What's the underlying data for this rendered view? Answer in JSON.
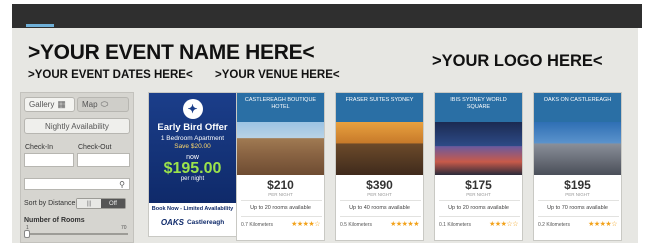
{
  "header": {
    "event_name": ">YOUR EVENT NAME HERE<",
    "event_dates": ">YOUR EVENT DATES HERE<",
    "event_venue": ">YOUR VENUE HERE<",
    "logo": ">YOUR LOGO HERE<"
  },
  "filters": {
    "gallery_label": "Gallery",
    "map_label": "Map",
    "nightly_availability": "Nightly Availability",
    "checkin_label": "Check-In",
    "checkout_label": "Check-Out",
    "checkin_value": "",
    "checkout_value": "",
    "search_value": "",
    "sort_label": "Sort by Distance",
    "toggle_off_label": "Off",
    "rooms_label": "Number of Rooms",
    "rooms_min": "1",
    "rooms_max": "70"
  },
  "ad": {
    "title": "Early Bird Offer",
    "subtitle": "1 Bedroom Apartment",
    "save": "Save $20.00",
    "now": "now",
    "price": "$195.00",
    "per": "per night",
    "cta": "Book Now - Limited Availability",
    "brand": "OAKS",
    "location": "Castlereagh",
    "bird_icon": "bird-icon"
  },
  "hotels": [
    {
      "name": "CASTLEREAGH BOUTIQUE HOTEL",
      "price": "$210",
      "price_note": "PER NIGHT",
      "rooms": "Up to 20 rooms available",
      "distance": "0.7 Kilometers",
      "stars": 4
    },
    {
      "name": "FRASER SUITES SYDNEY",
      "price": "$390",
      "price_note": "PER NIGHT",
      "rooms": "Up to 40 rooms available",
      "distance": "0.5 Kilometers",
      "stars": 5
    },
    {
      "name": "IBIS SYDNEY WORLD SQUARE",
      "price": "$175",
      "price_note": "PER NIGHT",
      "rooms": "Up to 20 rooms available",
      "distance": "0.1 Kilometers",
      "stars": 3
    },
    {
      "name": "OAKS ON CASTLEREAGH",
      "price": "$195",
      "price_note": "PER NIGHT",
      "rooms": "Up to 70 rooms available",
      "distance": "0.2 Kilometers",
      "stars": 4
    }
  ],
  "colors": {
    "card_header": "#2a6fa5",
    "ad_bg": "#1b3e8a",
    "ad_price": "#9be34b",
    "stars": "#f2a21b"
  }
}
